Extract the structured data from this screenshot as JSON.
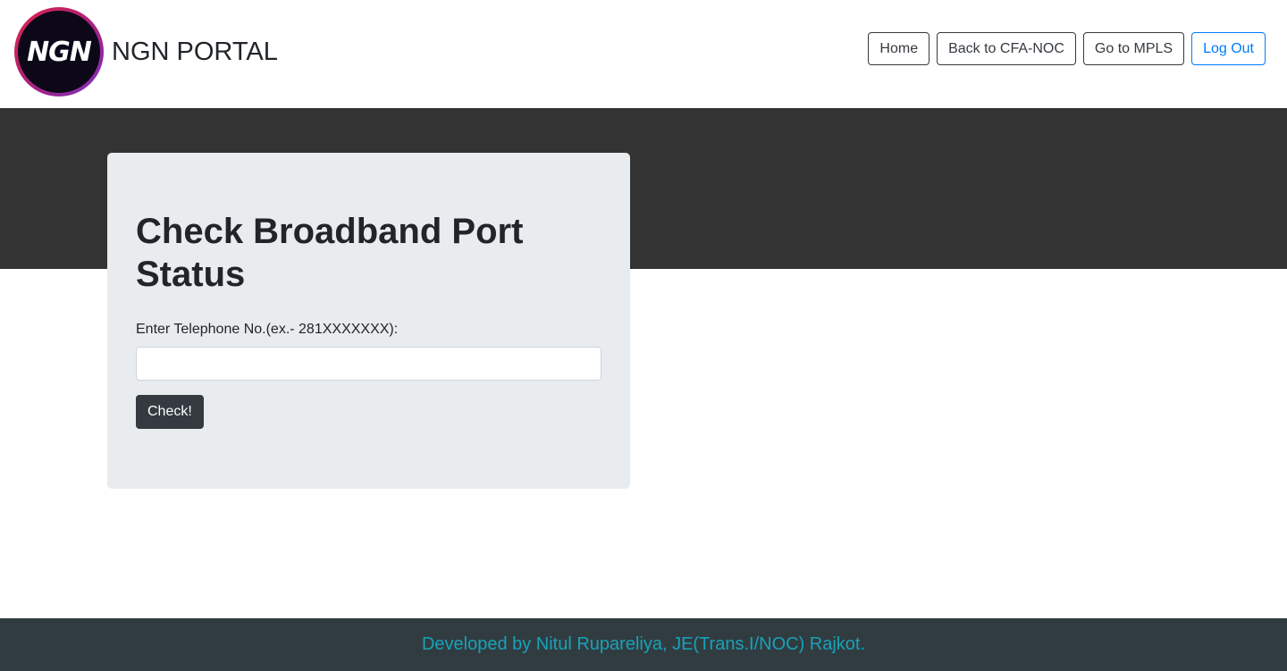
{
  "brand": {
    "logo_text": "NGN",
    "title": "NGN PORTAL"
  },
  "nav": {
    "home": "Home",
    "back": "Back to CFA-NOC",
    "mpls": "Go to MPLS",
    "logout": "Log Out"
  },
  "form": {
    "heading": "Check Broadband Port Status",
    "label": "Enter Telephone No.(ex.- 281XXXXXXX):",
    "input_value": "",
    "submit": "Check!"
  },
  "footer": {
    "text": "Developed by Nitul Rupareliya, JE(Trans.I/NOC) Rajkot."
  },
  "colors": {
    "hero_band": "#333333",
    "card_bg": "#e9ecef",
    "footer_bg": "#313c41",
    "footer_text": "#17a2b8",
    "primary": "#007bff",
    "dark": "#343a40"
  }
}
